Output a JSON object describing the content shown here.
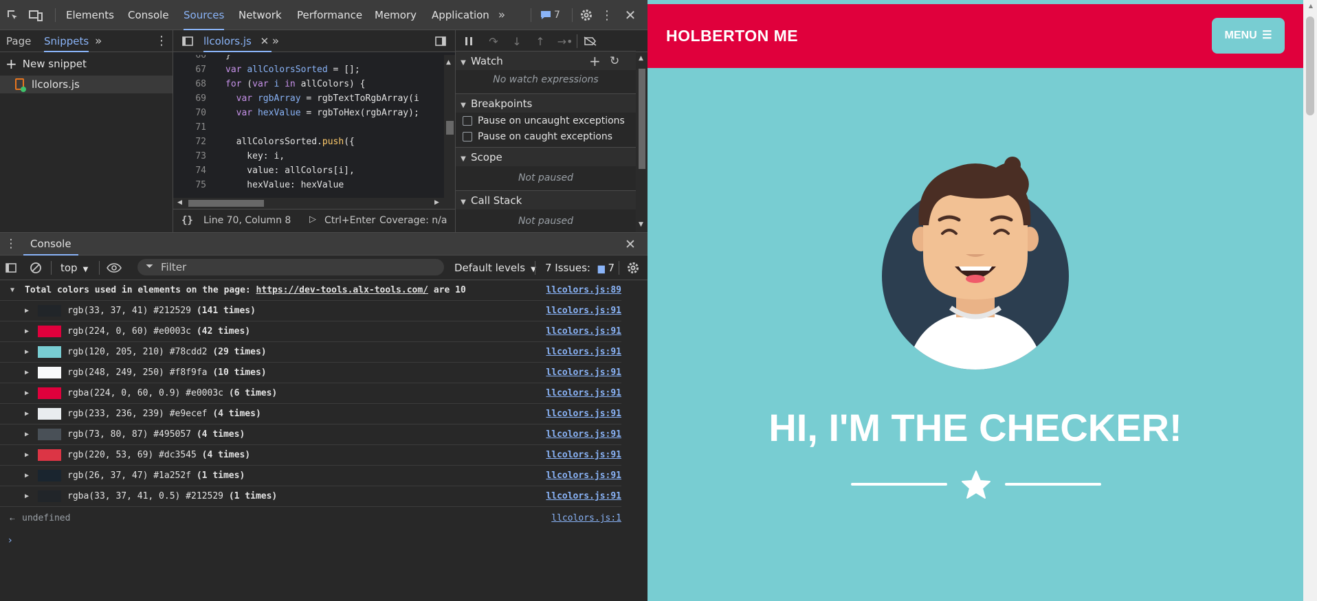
{
  "devtools": {
    "tabs": [
      "Elements",
      "Console",
      "Sources",
      "Network",
      "Performance",
      "Memory",
      "Application"
    ],
    "active_tab": "Sources",
    "issues_badge": "7",
    "navigator": {
      "tabs": [
        "Page",
        "Snippets"
      ],
      "active_tab": "Snippets",
      "new_snippet": "New snippet",
      "file": "llcolors.js"
    },
    "editor": {
      "tab": "llcolors.js",
      "lines": [
        {
          "n": "66",
          "t": [
            [
              "",
              "}"
            ]
          ]
        },
        {
          "n": "67",
          "t": [
            [
              "kw",
              "var "
            ],
            [
              "vr",
              "allColorsSorted"
            ],
            [
              "",
              " = [];"
            ]
          ]
        },
        {
          "n": "68",
          "t": [
            [
              "kw",
              "for"
            ],
            [
              "",
              " ("
            ],
            [
              "kw",
              "var"
            ],
            [
              "vr",
              " i"
            ],
            [
              "kw",
              " in"
            ],
            [
              "",
              " allColors) {"
            ]
          ]
        },
        {
          "n": "69",
          "t": [
            [
              "",
              "  "
            ],
            [
              "kw",
              "var "
            ],
            [
              "vr",
              "rgbArray"
            ],
            [
              "",
              " = rgbTextToRgbArray(i"
            ]
          ]
        },
        {
          "n": "70",
          "t": [
            [
              "",
              "  "
            ],
            [
              "kw",
              "var "
            ],
            [
              "vr",
              "hexValue"
            ],
            [
              "",
              " = rgbToHex(rgbArray);"
            ]
          ]
        },
        {
          "n": "71",
          "t": [
            [
              "",
              ""
            ]
          ]
        },
        {
          "n": "72",
          "t": [
            [
              "",
              "  allColorsSorted."
            ],
            [
              "fn",
              "push"
            ],
            [
              "",
              "({"
            ]
          ]
        },
        {
          "n": "73",
          "t": [
            [
              "",
              "    key: i,"
            ]
          ]
        },
        {
          "n": "74",
          "t": [
            [
              "",
              "    value: allColors[i],"
            ]
          ]
        },
        {
          "n": "75",
          "t": [
            [
              "",
              "    hexValue: hexValue"
            ]
          ]
        }
      ],
      "status_position": "Line 70, Column 8",
      "run_shortcut": "Ctrl+Enter",
      "coverage": "Coverage: n/a"
    },
    "debugger": {
      "watch": "Watch",
      "watch_empty": "No watch expressions",
      "breakpoints": "Breakpoints",
      "pause_uncaught": "Pause on uncaught exceptions",
      "pause_caught": "Pause on caught exceptions",
      "scope": "Scope",
      "scope_empty": "Not paused",
      "call_stack": "Call Stack",
      "call_stack_empty": "Not paused"
    },
    "console": {
      "drawer_tab": "Console",
      "context": "top",
      "filter_placeholder": "Filter",
      "levels": "Default levels",
      "issues_label": "7 Issues:",
      "issues_count": "7",
      "header": {
        "text_before": "Total colors used in elements on the page: ",
        "url": "https://dev-tools.alx-tools.com/",
        "text_after": " are 10",
        "source": "llcolors.js:89"
      },
      "rows": [
        {
          "swatch": "#212529",
          "text": "rgb(33, 37, 41) #212529 ",
          "count": "(141 times)",
          "source": "llcolors.js:91"
        },
        {
          "swatch": "#e0003c",
          "text": "rgb(224, 0, 60) #e0003c ",
          "count": "(42 times)",
          "source": "llcolors.js:91"
        },
        {
          "swatch": "#78cdd2",
          "text": "rgb(120, 205, 210) #78cdd2 ",
          "count": "(29 times)",
          "source": "llcolors.js:91"
        },
        {
          "swatch": "#f8f9fa",
          "text": "rgb(248, 249, 250) #f8f9fa ",
          "count": "(10 times)",
          "source": "llcolors.js:91"
        },
        {
          "swatch": "#e0003c",
          "text": "rgba(224, 0, 60, 0.9) #e0003c ",
          "count": "(6 times)",
          "source": "llcolors.js:91"
        },
        {
          "swatch": "#e9ecef",
          "text": "rgb(233, 236, 239) #e9ecef ",
          "count": "(4 times)",
          "source": "llcolors.js:91"
        },
        {
          "swatch": "#495057",
          "text": "rgb(73, 80, 87) #495057 ",
          "count": "(4 times)",
          "source": "llcolors.js:91"
        },
        {
          "swatch": "#dc3545",
          "text": "rgb(220, 53, 69) #dc3545 ",
          "count": "(4 times)",
          "source": "llcolors.js:91"
        },
        {
          "swatch": "#1a252f",
          "text": "rgb(26, 37, 47) #1a252f ",
          "count": "(1 times)",
          "source": "llcolors.js:91"
        },
        {
          "swatch": "#212529",
          "text": "rgba(33, 37, 41, 0.5) #212529 ",
          "count": "(1 times)",
          "source": "llcolors.js:91"
        }
      ],
      "result": "undefined",
      "result_source": "llcolors.js:1"
    }
  },
  "website": {
    "brand": "HOLBERTON ME",
    "menu_label": "MENU",
    "headline": "HI, I'M THE CHECKER!",
    "colors": {
      "header": "#e0003c",
      "background": "#78cdd2",
      "avatar_circle": "#2c3e50"
    }
  }
}
